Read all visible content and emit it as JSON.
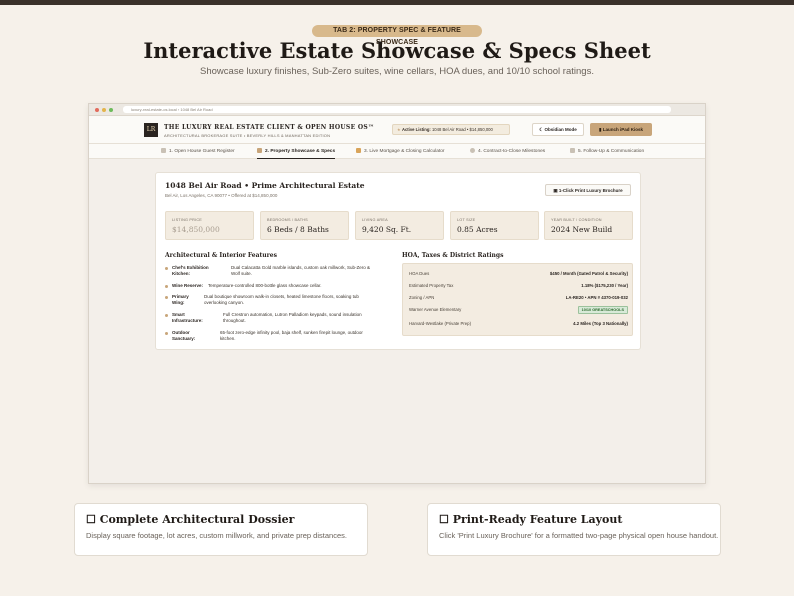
{
  "tag": "TAB 2: PROPERTY SPEC & FEATURE SHOWCASE",
  "hero": {
    "title": "Interactive Estate Showcase & Specs Sheet",
    "subtitle": "Showcase luxury finishes, Sub-Zero suites, wine cellars, HOA dues, and 10/10 school ratings."
  },
  "browser": {
    "url": "luxury-real-estate-os.local › 1048 Bel Air Road"
  },
  "app": {
    "logo": "LR",
    "name": "THE LUXURY REAL ESTATE CLIENT & OPEN HOUSE OS™",
    "subtitle": "ARCHITECTURAL BROKERAGE SUITE • BEVERLY HILLS & MANHATTAN EDITION",
    "active_label": "Active Listing:",
    "active_value": "1048 Bel Air Road • $14,850,000",
    "obsidian": "Obsidian Mode",
    "kiosk": "Launch iPad Kiosk"
  },
  "tabs": [
    {
      "label": "1. Open House Guest Register"
    },
    {
      "label": "2. Property Showcase & Specs"
    },
    {
      "label": "3. Live Mortgage & Closing Calculator"
    },
    {
      "label": "4. Contract-to-Close Milestones"
    },
    {
      "label": "5. Follow-Up & Communication"
    }
  ],
  "property": {
    "title": "1048 Bel Air Road • Prime Architectural Estate",
    "subtitle": "Bel Air, Los Angeles, CA 90077 • Offered at $14,850,000",
    "print_button": "1-Click Print Luxury Brochure"
  },
  "stats": [
    {
      "label": "LISTING PRICE",
      "value": "$14,850,000"
    },
    {
      "label": "BEDROOMS / BATHS",
      "value": "6 Beds / 8 Baths"
    },
    {
      "label": "LIVING AREA",
      "value": "9,420 Sq. Ft."
    },
    {
      "label": "LOT SIZE",
      "value": "0.85 Acres"
    },
    {
      "label": "YEAR BUILT / CONDITION",
      "value": "2024 New Build"
    }
  ],
  "features_heading": "Architectural & Interior Features",
  "features": [
    {
      "label1": "Chef's Exhibition",
      "label2": "Kitchen:",
      "desc1": "Dual Calacatta Gold marble islands, custom oak millwork, Sub-Zero &",
      "desc2": "Wolf suite."
    },
    {
      "label1": "Wine Reserve:",
      "label2": "",
      "desc1": "Temperature-controlled 800-bottle glass showcase cellar.",
      "desc2": ""
    },
    {
      "label1": "Primary",
      "label2": "Wing:",
      "desc1": "Dual boutique showroom walk-in closets, heated limestone floors, soaking tub",
      "desc2": "overlooking canyon."
    },
    {
      "label1": "Smart",
      "label2": "Infrastructure:",
      "desc1": "Full Crestron automation, Lutron Palladiom keypads, sound insulation",
      "desc2": "throughout."
    },
    {
      "label1": "Outdoor",
      "label2": "Sanctuary:",
      "desc1": "65-foot zero-edge infinity pool, baja shelf, sunken firepit lounge, outdoor",
      "desc2": "kitchen."
    }
  ],
  "hoa_heading": "HOA, Taxes & District Ratings",
  "hoa": [
    {
      "label": "HOA Dues",
      "value": "$450 / Month (Gated Patrol & Security)"
    },
    {
      "label": "Estimated Property Tax",
      "value": "1.18% ($175,230 / Year)"
    },
    {
      "label": "Zoning / APN",
      "value": "LA-RE20 • APN # 4370-019-032"
    },
    {
      "label": "Warner Avenue Elementary",
      "value": "10/10 GREATSCHOOLS"
    },
    {
      "label": "Harvard-Westlake (Private Prep)",
      "value": "4.2 Miles (Top 3 Nationally)"
    }
  ],
  "bottom": [
    {
      "title": "☐ Complete Architectural Dossier",
      "desc": "Display square footage, lot acres, custom millwork, and private prep distances."
    },
    {
      "title": "☐ Print-Ready Feature Layout",
      "desc": "Click 'Print Luxury Brochure' for a formatted two-page physical open house handout."
    }
  ],
  "colors": {
    "accent": "#c8a57a",
    "dark": "#2a2420",
    "background": "#f6f1ea",
    "badge": "#d8ead8"
  }
}
